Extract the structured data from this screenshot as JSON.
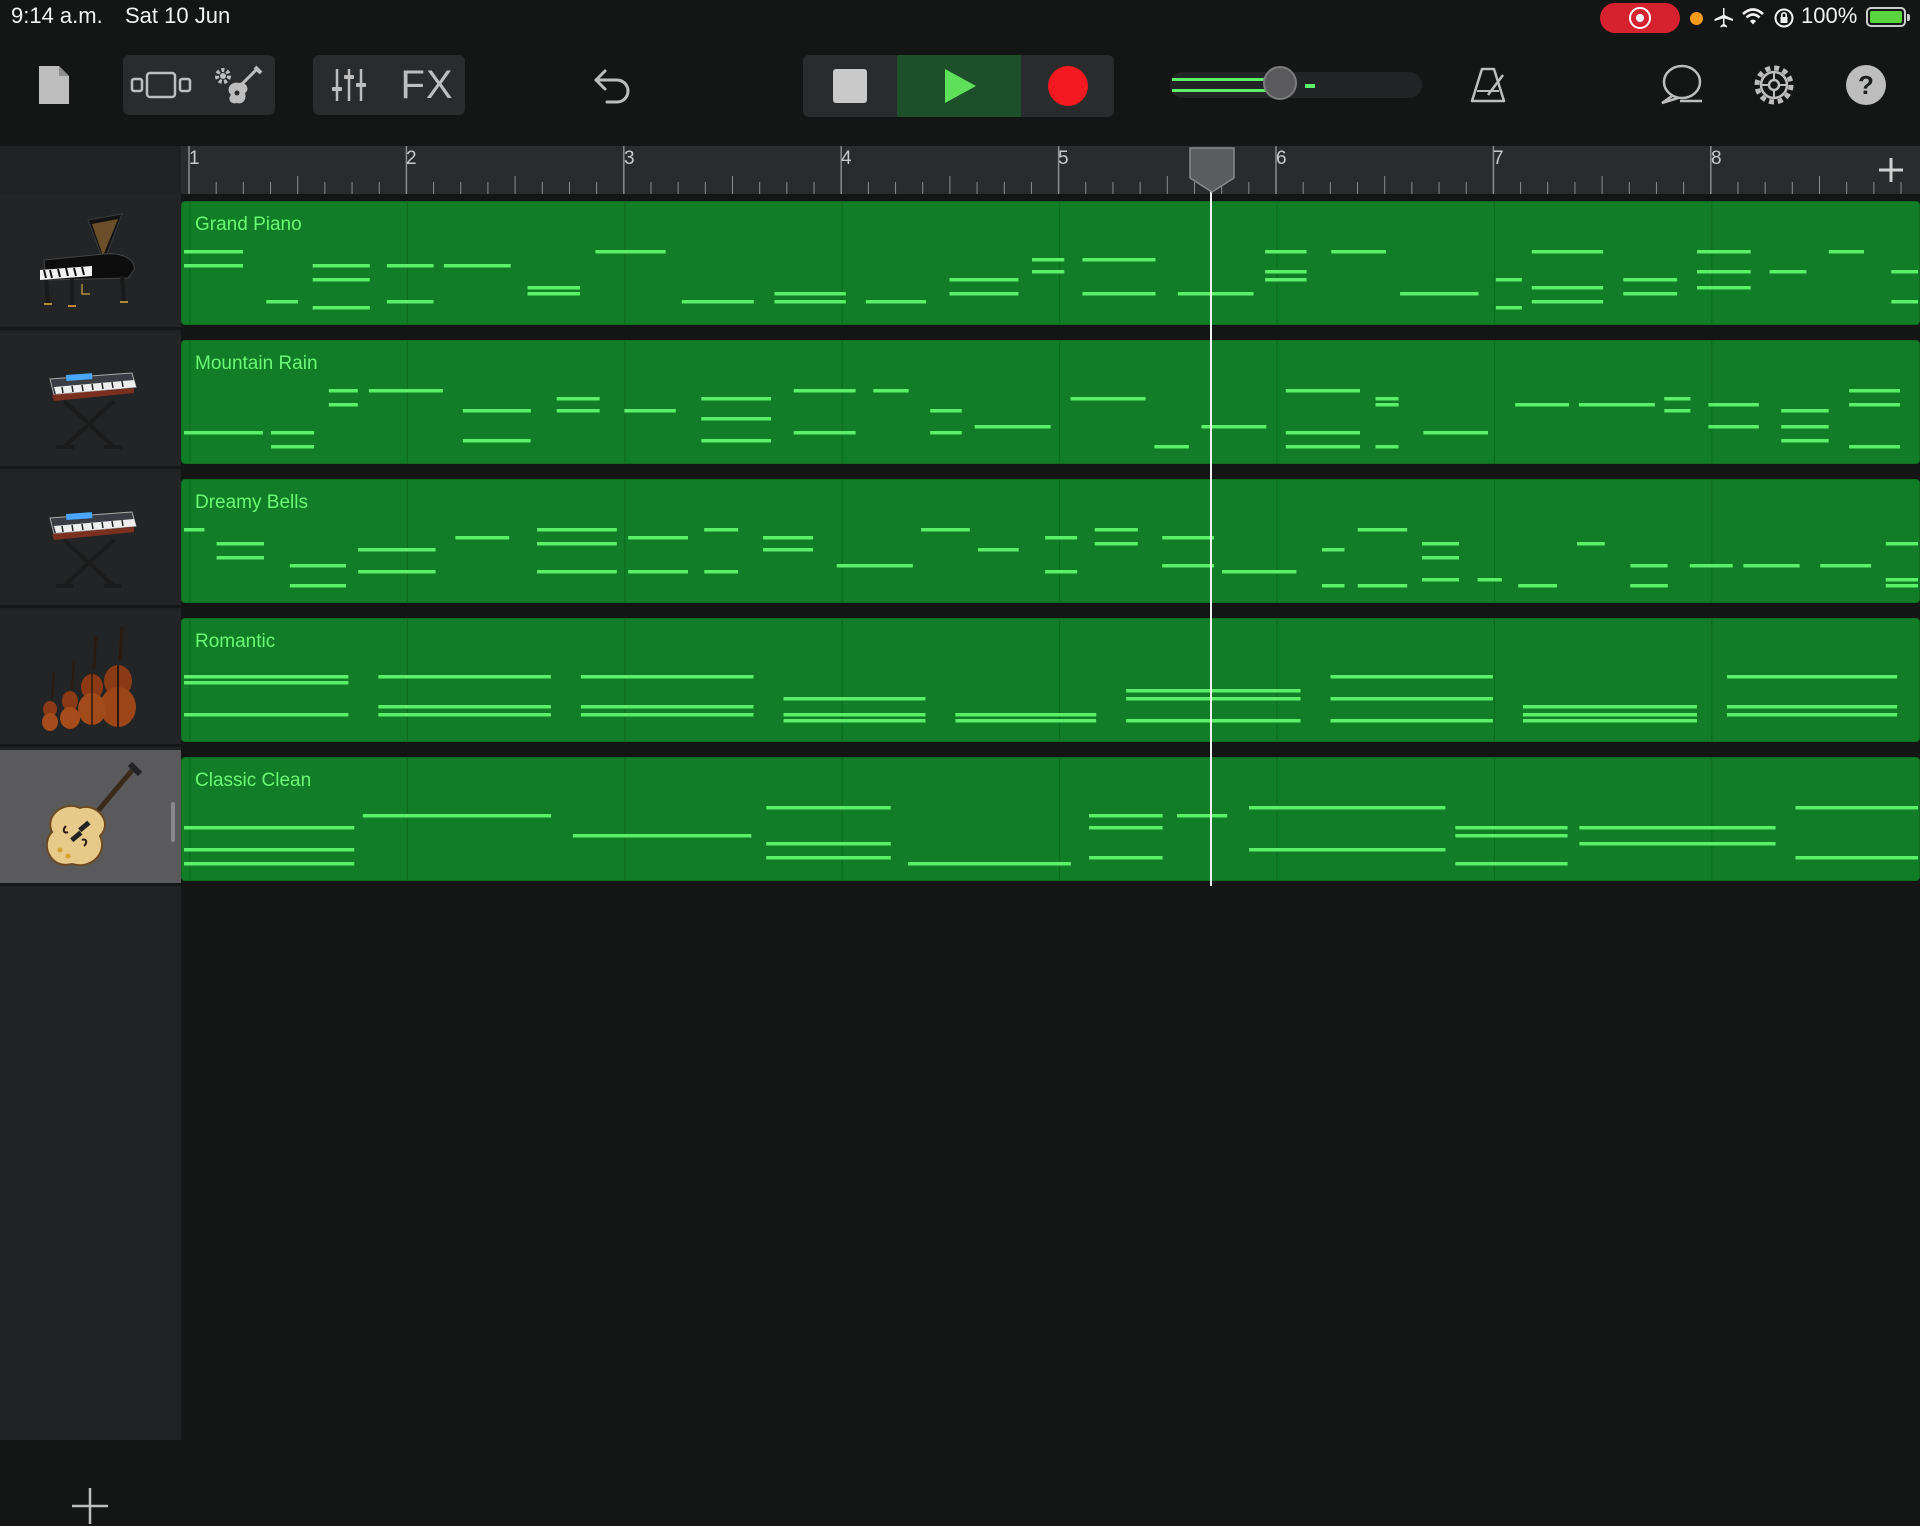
{
  "status_bar": {
    "time": "9:14 a.m.",
    "date": "Sat 10 Jun",
    "battery": "100%",
    "icons": [
      "screen-recording-icon",
      "mic-in-use-dot",
      "airplane-mode-icon",
      "wifi-icon",
      "orientation-lock-icon",
      "battery-charging-icon"
    ]
  },
  "toolbar": {
    "my_songs_icon": "document-icon",
    "tracks_view_icon": "tracks-view-icon",
    "browser_icon": "instrument-browser-icon",
    "mixer_icon": "mixer-sliders-icon",
    "fx_label": "FX",
    "undo_icon": "undo-icon",
    "stop_icon": "stop-icon",
    "play_icon": "play-icon",
    "record_icon": "record-icon",
    "master_volume": 0.42,
    "metronome_icon": "metronome-icon",
    "loop_icon": "loop-browser-icon",
    "settings_icon": "gear-icon",
    "help_label": "?"
  },
  "ruler": {
    "bars": [
      "1",
      "2",
      "3",
      "4",
      "5",
      "6",
      "7",
      "8"
    ],
    "add_section_label": "+"
  },
  "playhead": {
    "bar_position": 5.75
  },
  "tracks": [
    {
      "name": "Grand Piano",
      "instrument_icon": "grand-piano-icon",
      "selected": false
    },
    {
      "name": "Mountain Rain",
      "instrument_icon": "keyboard-synth-icon",
      "selected": false
    },
    {
      "name": "Dreamy Bells",
      "instrument_icon": "keyboard-synth-icon",
      "selected": false
    },
    {
      "name": "Romantic",
      "instrument_icon": "string-ensemble-icon",
      "selected": false
    },
    {
      "name": "Classic Clean",
      "instrument_icon": "electric-guitar-icon",
      "selected": true
    }
  ],
  "add_track_label": "+",
  "colors": {
    "region_fill": "#117d26",
    "note_color": "#5cf06a",
    "label_color": "#6df776",
    "record_red": "#f3191e",
    "play_green": "#5ee05a"
  }
}
